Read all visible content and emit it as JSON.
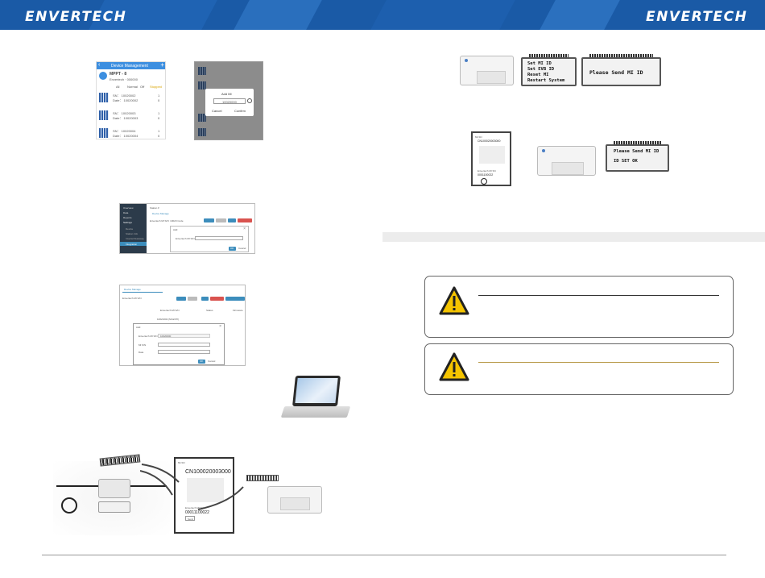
{
  "header": {
    "logo_left": "ENVERTECH",
    "logo_right": "ENVERTECH"
  },
  "app_screen": {
    "title": "Device Management",
    "device_name": "MPPT - 8",
    "device_sub": "Envertech · 000000",
    "filters": [
      "All",
      "Normal",
      "Off",
      "Stopped"
    ],
    "rows": [
      {
        "sn": "SN：   10020002",
        "val": "1"
      },
      {
        "sn": "Date：  10020002",
        "val": "0"
      },
      {
        "sn": "SN：   10020003",
        "val": "1"
      },
      {
        "sn": "Date：  10020003",
        "val": "0"
      },
      {
        "sn": "SN：   10020004",
        "val": "1"
      },
      {
        "sn": "Date：  10020004",
        "val": "0"
      }
    ]
  },
  "add_dialog": {
    "title": "Add MI",
    "value": "10020000",
    "cancel": "Cancel",
    "confirm": "Confirm"
  },
  "web_panel_1": {
    "menu": [
      "Overview",
      "Data",
      "Reports",
      "Settings",
      "Device",
      "Station Info",
      "Inverter/Gateway",
      "Integration"
    ],
    "crumb": "Station ▾",
    "tab": "Device Manage",
    "filter": "Envertech MI S/N: 10020 Code",
    "buttons": [
      "Search",
      "Clear",
      "Add",
      "Delete",
      "Batch Delete"
    ],
    "dialog_title": "Add",
    "field_label": "Envertech MI S/N",
    "ok": "OK",
    "cancel": "Cancel"
  },
  "web_panel_2": {
    "tab": "Device Manage",
    "filter": "Envertech MI S/N",
    "buttons": [
      "Search",
      "Clear",
      "Add",
      "Delete",
      "Batch Delete"
    ],
    "columns": [
      "Envertech MI S/N",
      "Status",
      "Firmware"
    ],
    "row_sn": "10021002 (MI-ESTI)",
    "dialog_title": "Add",
    "fields": [
      "Envertech MI S/N",
      "MI S/N",
      "Date"
    ],
    "field_value": "10020000",
    "ok": "OK",
    "cancel": "Cancel"
  },
  "gateway_window_big": {
    "title": "MI-SN",
    "sn": "CN100020003000",
    "label": "Envertech MI SN",
    "code": "00011100022",
    "btn": "Send"
  },
  "gateway_window_small": {
    "title": "MI-SN",
    "sn": "CN100020003000",
    "label": "Envertech MI SN",
    "code": "0001100022"
  },
  "lcd_menu": {
    "lines": [
      "Set MI ID",
      "Set EVB ID",
      "Reset MI",
      "Restart System"
    ]
  },
  "lcd_prompt_1": {
    "text": "Please Send MI ID"
  },
  "lcd_prompt_2": {
    "line1": "Please Send MI ID",
    "line2": "ID SET OK"
  },
  "colors": {
    "brand_blue": "#1a5aa6",
    "warning_yellow": "#f4c400",
    "warn_line_dark": "#333333",
    "warn_line_gold": "#b89a4a",
    "sidebar_dark": "#2c3b4a",
    "button_blue": "#3c8dbc",
    "button_red": "#d9534f"
  }
}
